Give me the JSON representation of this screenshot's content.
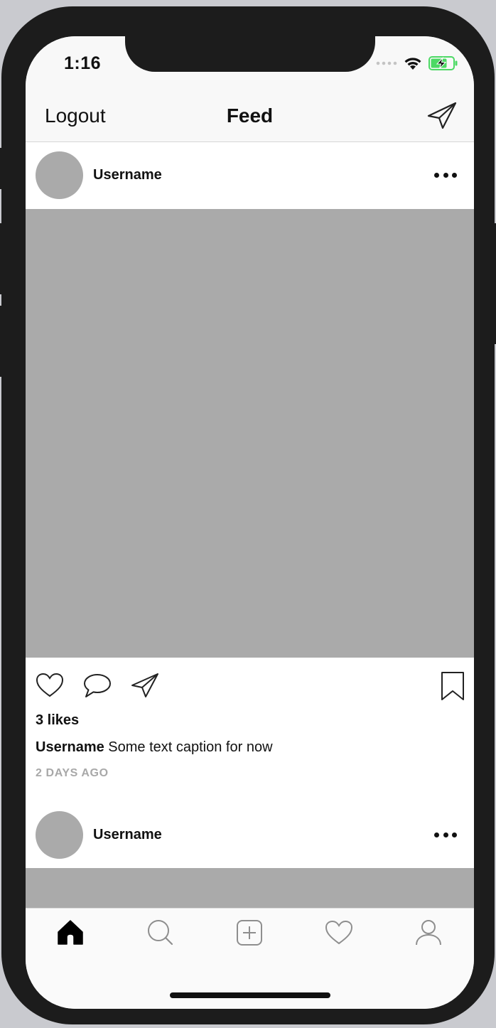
{
  "status_bar": {
    "time": "1:16"
  },
  "navbar": {
    "logout_label": "Logout",
    "title": "Feed",
    "send_icon": "paper-plane-icon"
  },
  "posts": [
    {
      "username": "Username",
      "likes": "3 likes",
      "caption_username": "Username",
      "caption_text": " Some text caption for now",
      "time_ago": "2 DAYS AGO"
    },
    {
      "username": "Username"
    }
  ],
  "tab_bar": {
    "tabs": [
      "home-icon",
      "search-icon",
      "add-post-icon",
      "heart-icon",
      "profile-icon"
    ],
    "active_tab": "home-icon"
  },
  "colors": {
    "placeholder_gray": "#aaaaaa",
    "battery_green": "#4cd964",
    "muted_text": "#a8a8a8"
  }
}
